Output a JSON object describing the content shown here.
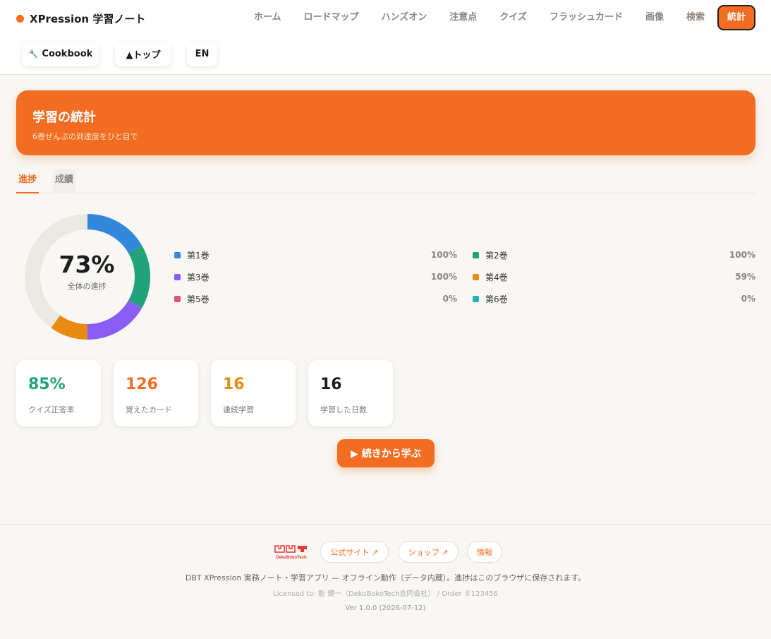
{
  "brand": {
    "name": "XPression 学習ノート"
  },
  "nav": {
    "items": [
      "ホーム",
      "ロードマップ",
      "ハンズオン",
      "注意点",
      "クイズ",
      "フラッシュカード",
      "画像",
      "検索"
    ],
    "active": "統計"
  },
  "subnav": {
    "cookbook": "Cookbook",
    "top": "▲トップ",
    "lang": "EN"
  },
  "hero": {
    "title": "学習の統計",
    "subtitle": "6巻ぜんぶの到達度をひと目で"
  },
  "tabs": [
    "進捗",
    "成績"
  ],
  "progress": {
    "overall_value": 73,
    "overall": "73%",
    "caption": "全体の進捗",
    "volumes": [
      {
        "label": "第1巻",
        "value": 100,
        "display": "100%",
        "color": "#3388dd"
      },
      {
        "label": "第2巻",
        "value": 100,
        "display": "100%",
        "color": "#22a27a"
      },
      {
        "label": "第3巻",
        "value": 100,
        "display": "100%",
        "color": "#8b5cf6"
      },
      {
        "label": "第4巻",
        "value": 59,
        "display": "59%",
        "color": "#e88b12"
      },
      {
        "label": "第5巻",
        "value": 0,
        "display": "0%",
        "color": "#e0517f"
      },
      {
        "label": "第6巻",
        "value": 0,
        "display": "0%",
        "color": "#27b1b5"
      }
    ]
  },
  "stats": [
    {
      "value": "85%",
      "label": "クイズ正答率",
      "color": "#22a27a"
    },
    {
      "value": "126",
      "label": "覚えたカード",
      "color": "#f26d21"
    },
    {
      "value": "16",
      "label": "連続学習",
      "color": "#e88b12"
    },
    {
      "value": "16",
      "label": "学習した日数",
      "color": "#1d1d1f"
    }
  ],
  "cta": {
    "label": "▶ 続きから学ぶ"
  },
  "footer": {
    "logo_text": "DekoBokoTech",
    "links": [
      "公式サイト ↗",
      "ショップ ↗",
      "情報"
    ],
    "description": "DBT XPression 実務ノート・学習アプリ — オフライン動作（データ内蔵）。進捗はこのブラウザに保存されます。",
    "license": "Licensed to: 能 健一（DekoBokoTech合同会社） / Order ＃123456",
    "version": "Ver 1.0.0 (2026-07-12)"
  },
  "colors": {
    "accent": "#f26d21",
    "ring_bg": "#ebe8e2"
  }
}
